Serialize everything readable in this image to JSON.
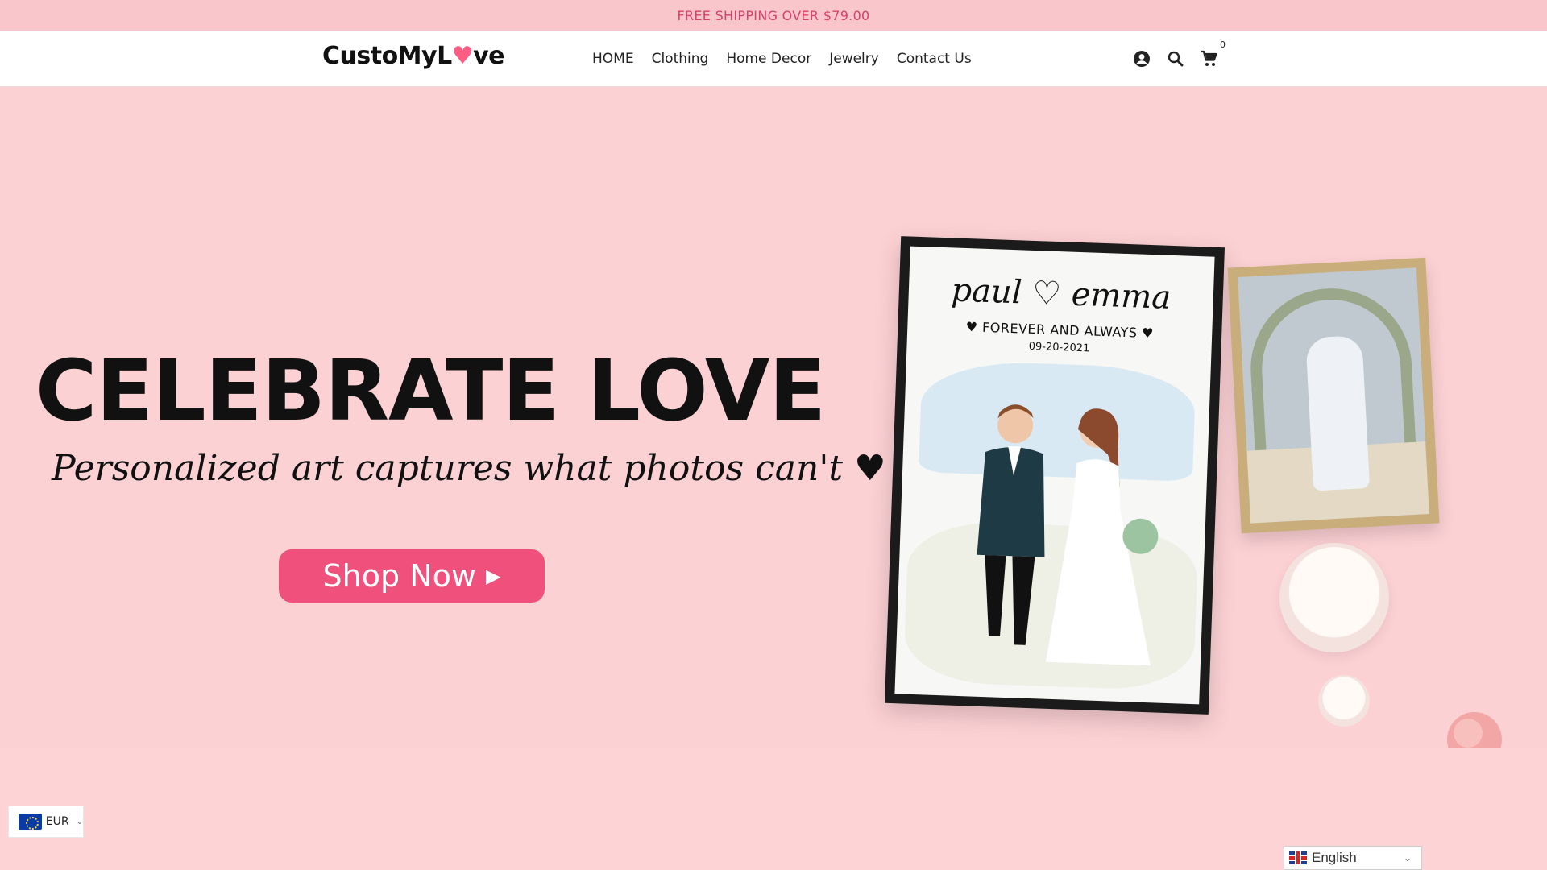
{
  "announcement": "FREE SHIPPING OVER $79.00",
  "header": {
    "logo": {
      "part1": "CustoMyL",
      "heart": "♥",
      "part2": "ve"
    },
    "nav": [
      "HOME",
      "Clothing",
      "Home Decor",
      "Jewelry",
      "Contact Us"
    ],
    "icons": [
      "account-icon",
      "search-icon",
      "cart-icon"
    ],
    "cart_count": "0"
  },
  "hero": {
    "title": "CELEBRATE LOVE",
    "subtitle": "Personalized art captures what photos can't",
    "subtitle_heart": "♥",
    "button_label": "Shop Now",
    "button_arrow": "▶",
    "accent_color": "#f0517c",
    "artwork": {
      "names": "paul ♡ emma",
      "tagline": "♥ FOREVER AND ALWAYS ♥",
      "date": "09-20-2021"
    }
  },
  "currency": {
    "code": "EUR",
    "flag_icon": "eu-flag-icon"
  },
  "language": {
    "label": "English",
    "flag_icon": "uk-flag-icon"
  }
}
